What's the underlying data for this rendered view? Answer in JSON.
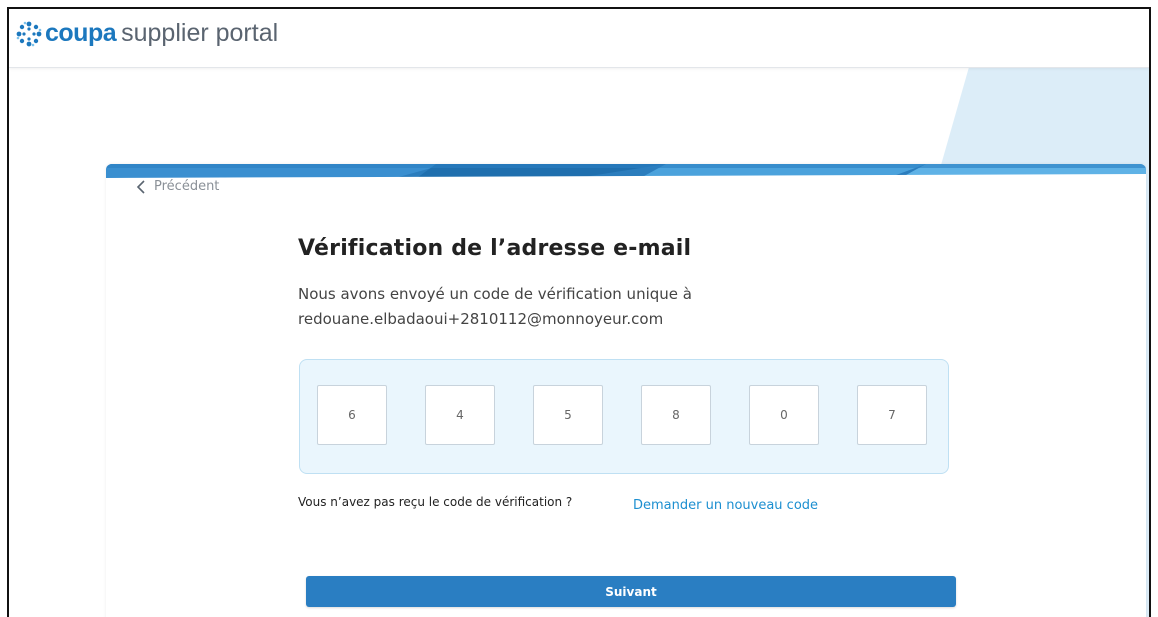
{
  "header": {
    "logo_brand": "coupa",
    "logo_product": "supplier portal"
  },
  "card": {
    "back_label": "Précédent",
    "title": "Vérification de l’adresse e-mail",
    "description_line1": "Nous avons envoyé un code de vérification unique à",
    "description_line2": "redouane.elbadaoui+2810112@monnoyeur.com",
    "code_digits": [
      "6",
      "4",
      "5",
      "8",
      "0",
      "7"
    ],
    "resend_prompt": "Vous n’avez pas reçu le code de vérification ?",
    "resend_link": "Demander un nouveau code",
    "next_button": "Suivant"
  },
  "colors": {
    "brand_blue": "#1c78be",
    "button_blue": "#2a7ec2",
    "link_blue": "#1c8fd0",
    "code_box_bg": "#eaf6fd"
  },
  "icons": {
    "logo": "coupa-flower-icon",
    "back": "chevron-left-icon"
  }
}
